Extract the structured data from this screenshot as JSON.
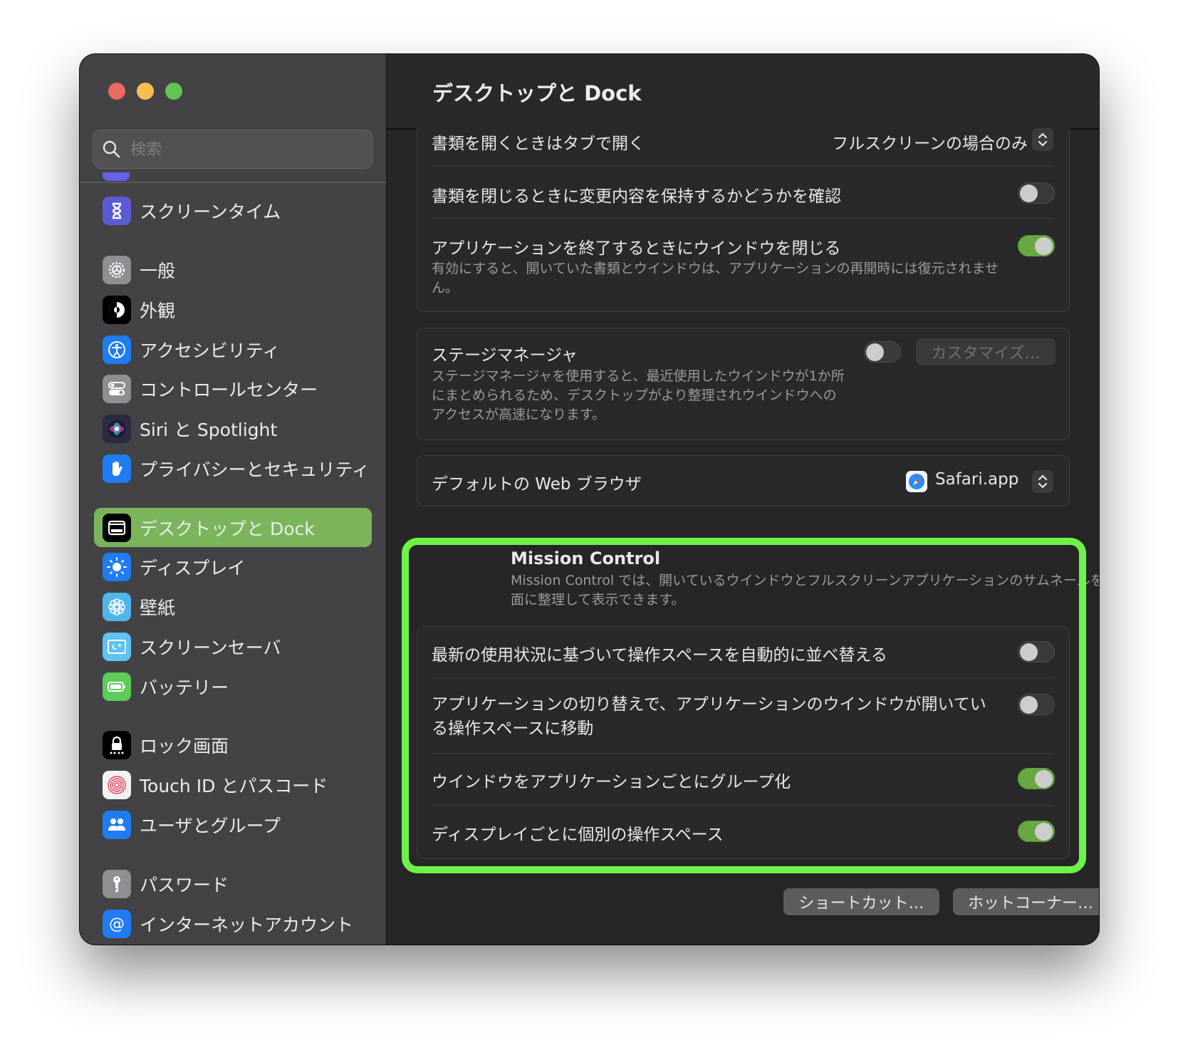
{
  "window": {
    "traffic_lights": {
      "close": "#ec6a5e",
      "minimize": "#f4bf4f",
      "maximize": "#61c554"
    }
  },
  "sidebar": {
    "search_placeholder": "検索",
    "search_value": "",
    "selected_color": "#7ab55c",
    "items": [
      {
        "label": "スクリーンタイム",
        "icon": "hourglass-icon",
        "color": "#5b5bd6"
      },
      {
        "label": "一般",
        "icon": "gear-icon",
        "color": "#8e8e93"
      },
      {
        "label": "外観",
        "icon": "appearance-icon",
        "color": "#000000"
      },
      {
        "label": "アクセシビリティ",
        "icon": "accessibility-icon",
        "color": "#1f7cf2"
      },
      {
        "label": "コントロールセンター",
        "icon": "control-center-icon",
        "color": "#8e8e93"
      },
      {
        "label": "Siri と Spotlight",
        "icon": "siri-icon",
        "color": "#2a2a40"
      },
      {
        "label": "プライバシーとセキュリティ",
        "icon": "hand-icon",
        "color": "#1f7cf2"
      },
      {
        "label": "デスクトップと Dock",
        "icon": "dock-icon",
        "color": "#000000",
        "selected": true
      },
      {
        "label": "ディスプレイ",
        "icon": "sun-icon",
        "color": "#1f7cf2"
      },
      {
        "label": "壁紙",
        "icon": "flower-icon",
        "color": "#4fb6ea"
      },
      {
        "label": "スクリーンセーバ",
        "icon": "screensaver-icon",
        "color": "#5ec3f0"
      },
      {
        "label": "バッテリー",
        "icon": "battery-icon",
        "color": "#5ecb5a"
      },
      {
        "label": "ロック画面",
        "icon": "lock-icon",
        "color": "#000000"
      },
      {
        "label": "Touch ID とパスコード",
        "icon": "fingerprint-icon",
        "color": "#f2f2f2"
      },
      {
        "label": "ユーザとグループ",
        "icon": "users-icon",
        "color": "#1f7cf2"
      },
      {
        "label": "パスワード",
        "icon": "key-icon",
        "color": "#8e8e93"
      },
      {
        "label": "インターネットアカウント",
        "icon": "at-icon",
        "color": "#1f7cf2"
      }
    ]
  },
  "main": {
    "title": "デスクトップと Dock",
    "windows_group": {
      "open_in_tabs": {
        "label": "書類を開くときはタブで開く",
        "value": "フルスクリーンの場合のみ"
      },
      "ask_keep_changes": {
        "label": "書類を閉じるときに変更内容を保持するかどうかを確認",
        "on": false
      },
      "close_windows_on_quit": {
        "label": "アプリケーションを終了するときにウインドウを閉じる",
        "description": "有効にすると、開いていた書類とウインドウは、アプリケーションの再開時には復元されません。",
        "on": true
      }
    },
    "stage_manager": {
      "label": "ステージマネージャ",
      "description": "ステージマネージャを使用すると、最近使用したウインドウが1か所にまとめられるため、デスクトップがより整理されウインドウへのアクセスが高速になります。",
      "on": false,
      "customize_label": "カスタマイズ…"
    },
    "default_browser": {
      "label": "デフォルトの Web ブラウザ",
      "value": "Safari.app",
      "icon": "safari-icon"
    },
    "mission_control": {
      "title": "Mission Control",
      "description": "Mission Control では、開いているウインドウとフルスクリーンアプリケーションのサムネールを一画面に整理して表示できます。",
      "highlight_color": "#6ef24a",
      "options": [
        {
          "label": "最新の使用状況に基づいて操作スペースを自動的に並べ替える",
          "on": false
        },
        {
          "label": "アプリケーションの切り替えで、アプリケーションのウインドウが開いている操作スペースに移動",
          "on": false
        },
        {
          "label": "ウインドウをアプリケーションごとにグループ化",
          "on": true
        },
        {
          "label": "ディスプレイごとに個別の操作スペース",
          "on": true
        }
      ]
    },
    "footer": {
      "shortcuts_label": "ショートカット…",
      "hot_corners_label": "ホットコーナー…",
      "help_label": "?"
    },
    "toggle_on_color": "#67a843"
  }
}
